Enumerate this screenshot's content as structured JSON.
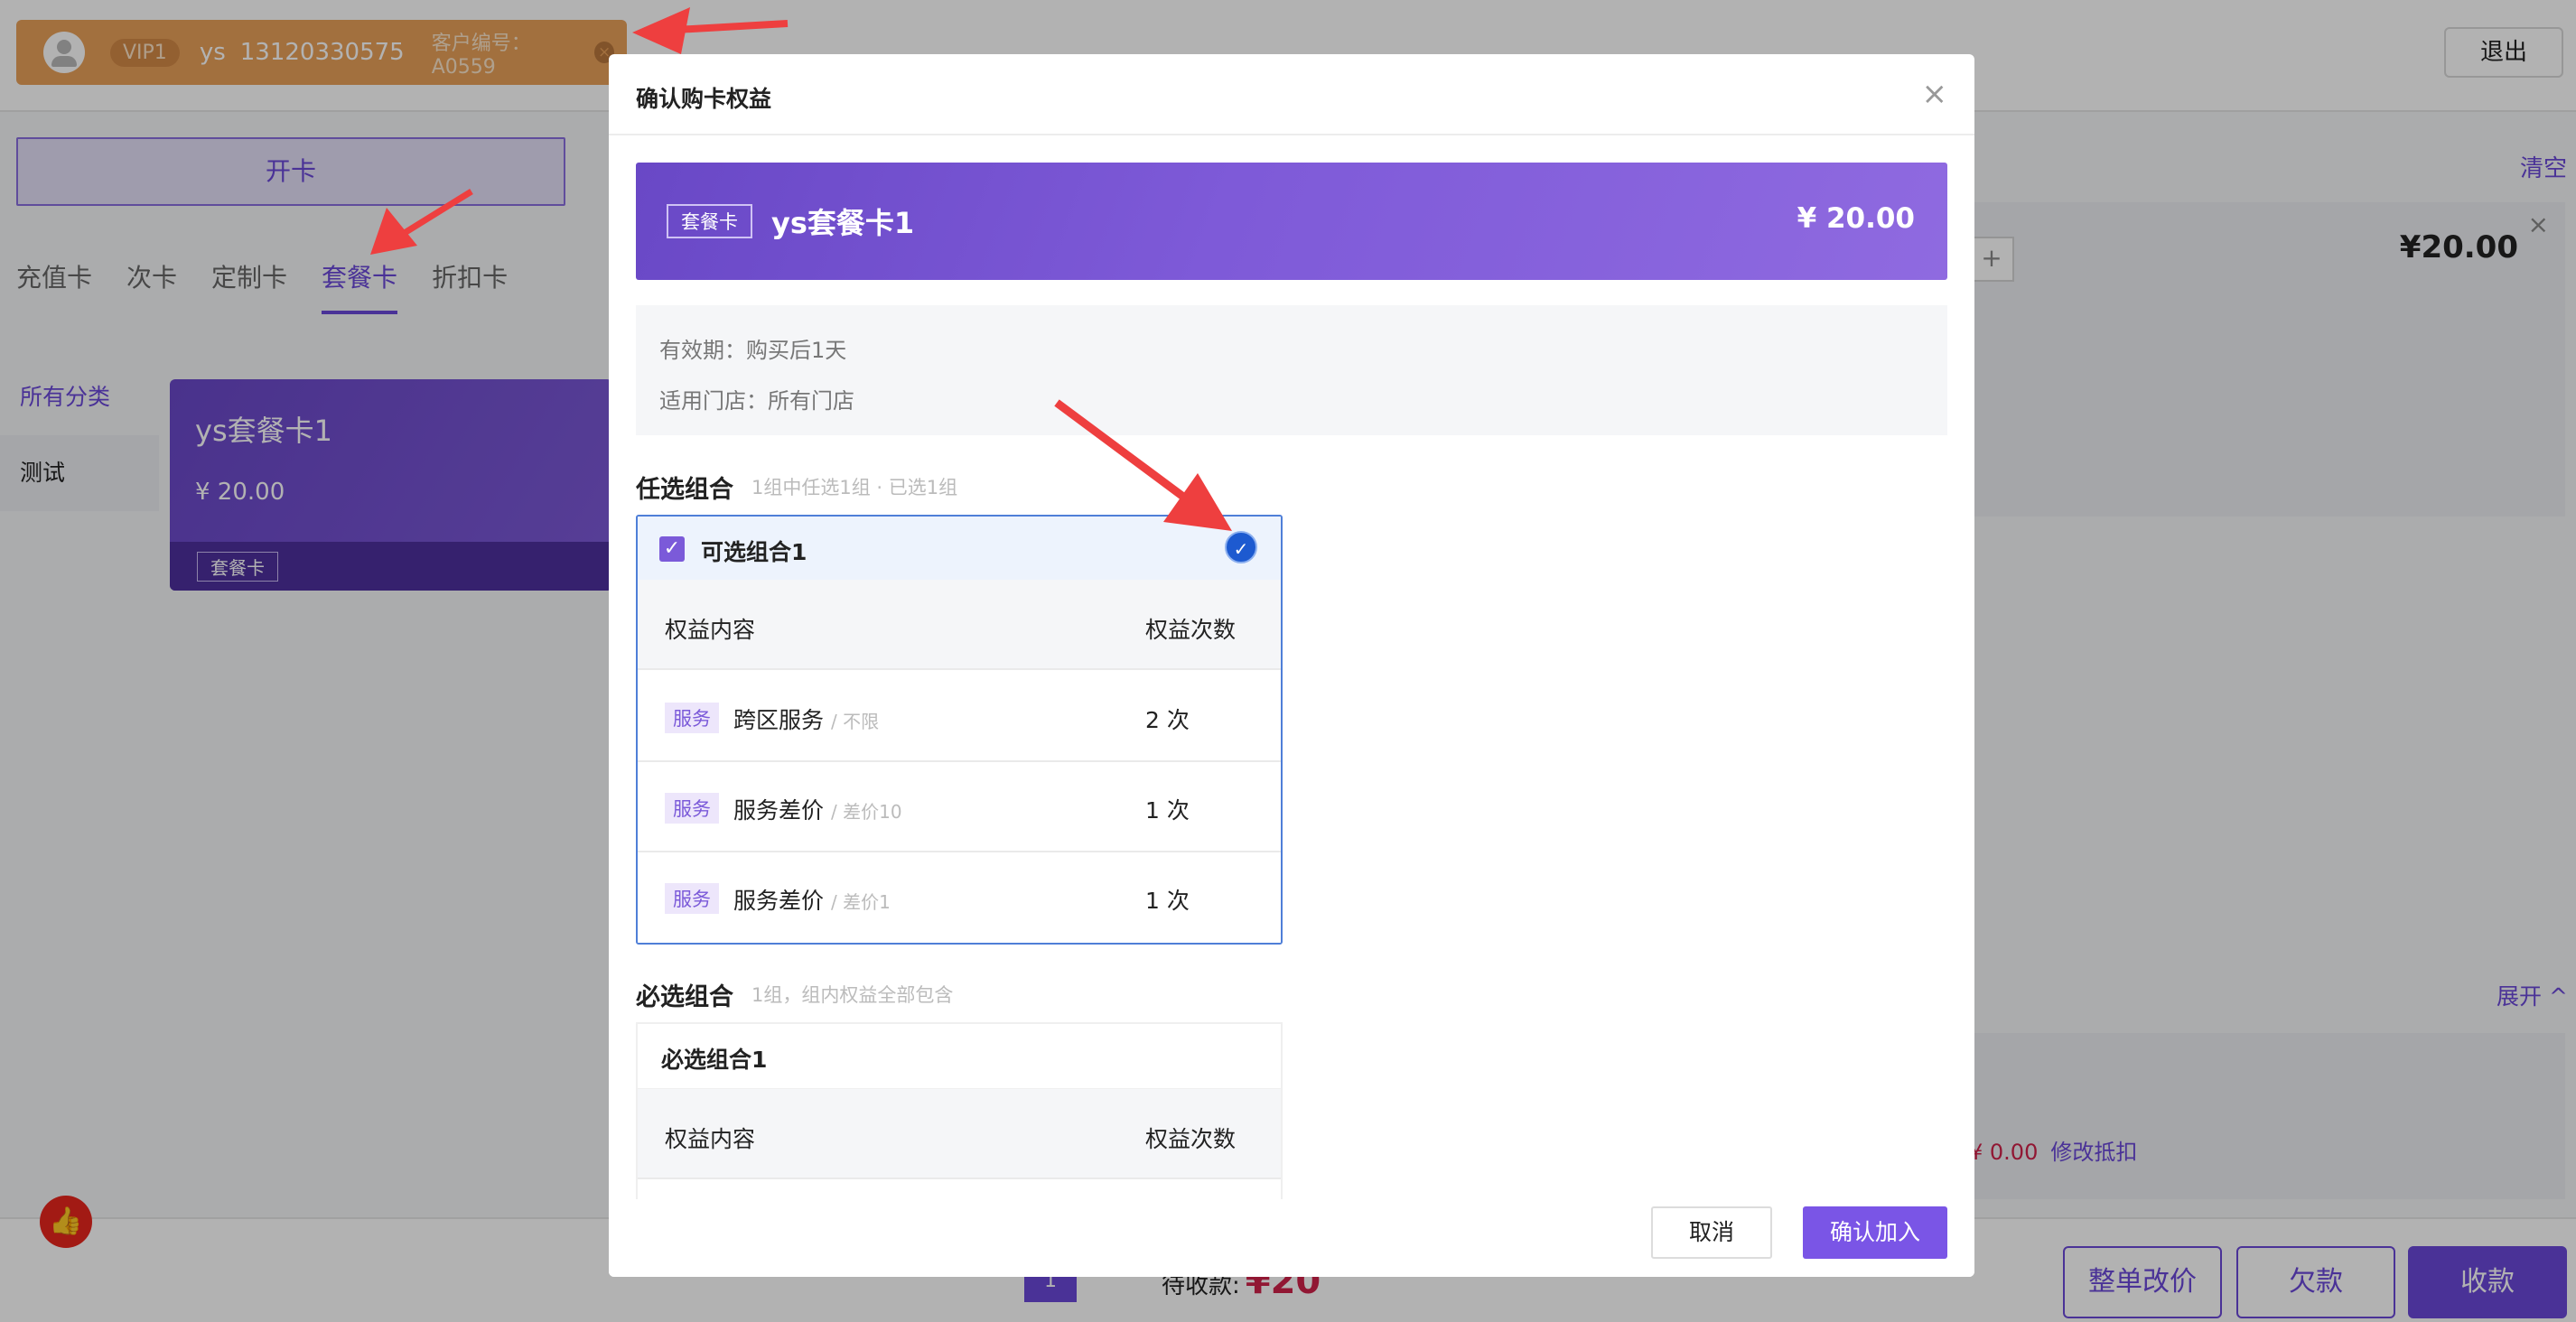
{
  "header": {
    "customer": {
      "vip": "VIP1",
      "name": "ys",
      "phone": "13120330575",
      "customer_no": "客户编号：A0559",
      "close_icon": "×"
    },
    "logout_label": "退出"
  },
  "left": {
    "open_card_label": "开卡",
    "tabs": [
      "充值卡",
      "次卡",
      "定制卡",
      "套餐卡",
      "折扣卡"
    ],
    "active_tab": "套餐卡",
    "categories": [
      "所有分类",
      "测试"
    ],
    "product_card": {
      "title": "ys套餐卡1",
      "price": "¥ 20.00",
      "tag": "套餐卡"
    }
  },
  "right": {
    "clear_label": "清空",
    "item_price": "¥20.00",
    "plus": "+",
    "remove": "×",
    "expand_label": "展开 ^",
    "deduct_amount": "¥ 0.00",
    "deduct_edit_label": "修改抵扣"
  },
  "footer": {
    "page": "1",
    "pending_label": "待收款:",
    "pending_amount": "¥20",
    "buttons": [
      "整单改价",
      "欠款",
      "收款"
    ],
    "like_icon": "👍"
  },
  "modal": {
    "title": "确认购卡权益",
    "close": "×",
    "banner": {
      "tag": "套餐卡",
      "name": "ys套餐卡1",
      "price": "¥ 20.00"
    },
    "validity": "有效期：购买后1天",
    "stores": "适用门店：所有门店",
    "optional": {
      "title": "任选组合",
      "hint": "1组中任选1组 · 已选1组",
      "group_name": "可选组合1",
      "checked_mark": "✓",
      "selected_mark": "✓",
      "col_content": "权益内容",
      "col_count": "权益次数",
      "rows": [
        {
          "tag": "服务",
          "name": "跨区服务",
          "note": "/ 不限",
          "count": "2 次"
        },
        {
          "tag": "服务",
          "name": "服务差价",
          "note": "/ 差价10",
          "count": "1 次"
        },
        {
          "tag": "服务",
          "name": "服务差价",
          "note": "/ 差价1",
          "count": "1 次"
        }
      ]
    },
    "required": {
      "title": "必选组合",
      "hint": "1组，组内权益全部包含",
      "group_name": "必选组合1",
      "col_content": "权益内容",
      "col_count": "权益次数"
    },
    "cancel_label": "取消",
    "confirm_label": "确认加入"
  },
  "colors": {
    "accent": "#6a48d9",
    "customer_bar": "#e9a15a",
    "selected_border": "#4f7fd8",
    "price_red": "#d0224a",
    "annotation_arrow": "#ee3f3f"
  },
  "icons": [
    "avatar-icon",
    "close-icon",
    "check-icon",
    "selected-check-icon",
    "thumbs-up-icon",
    "annotation-arrow"
  ]
}
